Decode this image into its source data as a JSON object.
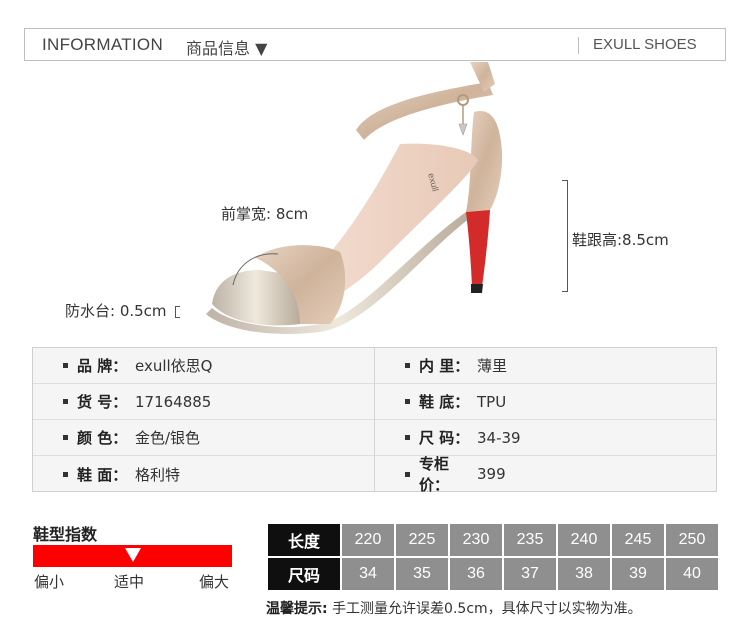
{
  "header": {
    "title_en": "INFORMATION",
    "title_cn": "商品信息 ▼",
    "brand": "EXULL SHOES"
  },
  "product": {
    "forefoot_width": "前掌宽: 8cm",
    "heel_height": "鞋跟高:8.5cm",
    "platform": "防水台: 0.5cm",
    "insole_brand": "exull"
  },
  "info_rows": [
    {
      "left_label": "品 牌：",
      "left_value": "exull依思Q",
      "right_label": "内 里：",
      "right_value": "薄里"
    },
    {
      "left_label": "货 号：",
      "left_value": "17164885",
      "right_label": "鞋 底：",
      "right_value": "TPU"
    },
    {
      "left_label": "颜 色：",
      "left_value": "金色/银色",
      "right_label": "尺 码：",
      "right_value": "34-39"
    },
    {
      "left_label": "鞋 面：",
      "left_value": "格利特",
      "right_label": "专柜价：",
      "right_value": "399"
    }
  ],
  "fit": {
    "title": "鞋型指数",
    "labels": [
      "偏小",
      "适中",
      "偏大"
    ],
    "level": 0.5,
    "bar_color": "#ff0000"
  },
  "size_table": {
    "length_label": "长度",
    "size_label": "尺码",
    "lengths": [
      "220",
      "225",
      "230",
      "235",
      "240",
      "245",
      "250"
    ],
    "sizes": [
      "34",
      "35",
      "36",
      "37",
      "38",
      "39",
      "40"
    ]
  },
  "tip": {
    "label": "温馨提示:",
    "text": "手工测量允许误差0.5cm，具体尺寸以实物为准。"
  },
  "colors": {
    "header_head": "#0f0f0f",
    "cell_bg": "#8f8f8f",
    "sole_red": "#d32a2a",
    "gold_glitter": "#d9c1ab"
  }
}
